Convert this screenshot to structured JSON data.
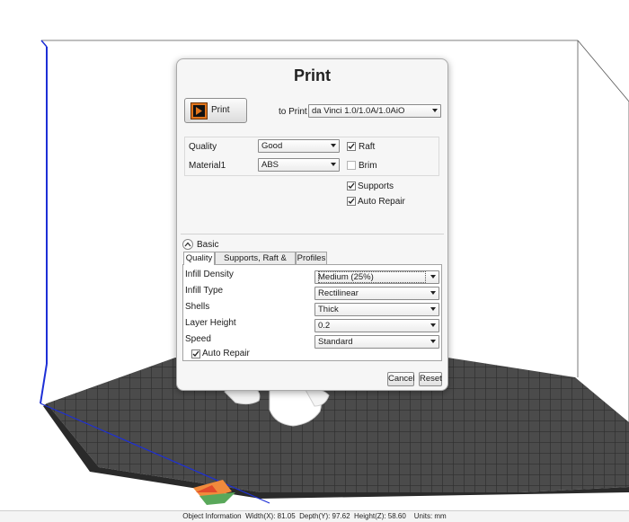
{
  "dialog": {
    "title": "Print",
    "print_button_label": "Print",
    "to_print_label": "to Print",
    "printer_value": "da Vinci 1.0/1.0A/1.0AiO",
    "quality_label": "Quality",
    "quality_value": "Good",
    "material_label": "Material1",
    "material_value": "ABS",
    "raft_label": "Raft",
    "raft_checked": true,
    "brim_label": "Brim",
    "brim_checked": false,
    "supports_label": "Supports",
    "supports_checked": true,
    "auto_repair_label": "Auto Repair",
    "auto_repair_checked": true,
    "basic_label": "Basic",
    "tabs": [
      "Quality",
      "Supports, Raft & Brim",
      "Profiles"
    ],
    "active_tab": "Quality",
    "settings": {
      "infill_density_label": "Infill Density",
      "infill_density_value": "Medium (25%)",
      "infill_type_label": "Infill Type",
      "infill_type_value": "Rectilinear",
      "shells_label": "Shells",
      "shells_value": "Thick",
      "layer_height_label": "Layer Height",
      "layer_height_value": "0.2",
      "speed_label": "Speed",
      "speed_value": "Standard",
      "auto_repair_label": "Auto Repair",
      "auto_repair_checked": true
    },
    "cancel_label": "Cancel",
    "reset_label": "Reset"
  },
  "statusbar": {
    "text": "Object Information  Width(X): 81.05  Depth(Y): 97.62  Height(Z): 58.60    Units: mm"
  },
  "colors": {
    "build_volume_edge": "#1d2fd6",
    "print_icon": "#e0741c",
    "bed_grid": "#3a3a3a"
  }
}
